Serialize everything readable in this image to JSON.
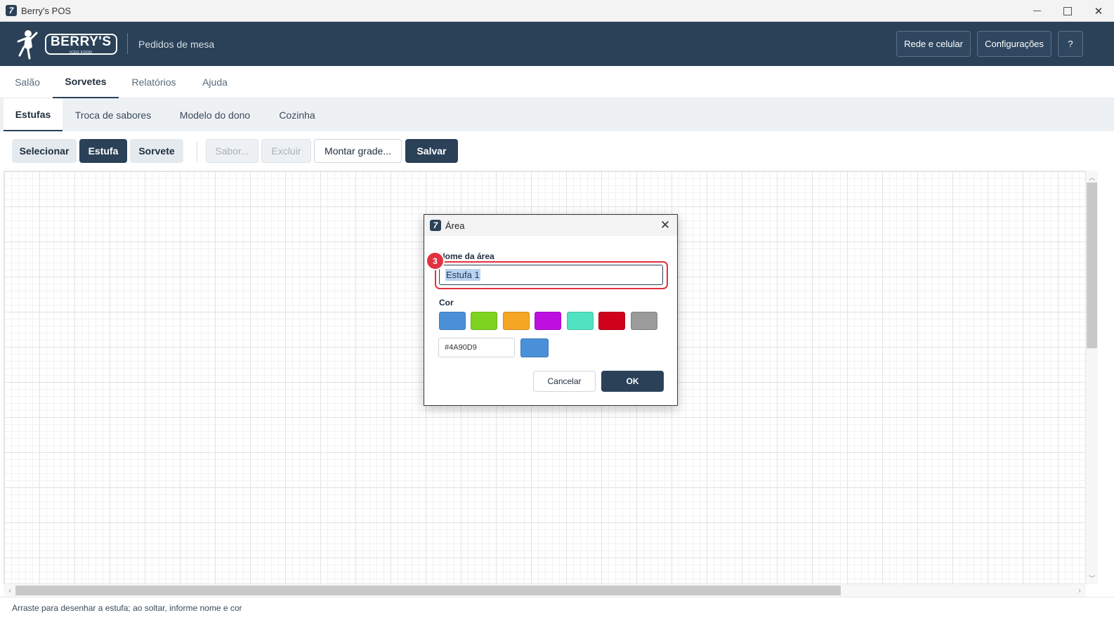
{
  "window": {
    "title": "Berry's POS",
    "app_icon_glyph": "7"
  },
  "header": {
    "logo_text": "BERRY'S",
    "logo_subtext": "ICED FOOD",
    "subtitle": "Pedidos de mesa",
    "buttons": {
      "network": "Rede e celular",
      "settings": "Configurações",
      "help": "?"
    }
  },
  "main_tabs": [
    "Salão",
    "Sorvetes",
    "Relatórios",
    "Ajuda"
  ],
  "main_tab_active": "Sorvetes",
  "sub_tabs": [
    "Estufas",
    "Troca de sabores",
    "Modelo do dono",
    "Cozinha"
  ],
  "sub_tab_active": "Estufas",
  "toolbar": {
    "select": "Selecionar",
    "estufa": "Estufa",
    "sorvete": "Sorvete",
    "sabor": "Sabor...",
    "excluir": "Excluir",
    "montar_grade": "Montar grade...",
    "salvar": "Salvar"
  },
  "status": {
    "text": "Arraste para desenhar a estufa; ao soltar, informe nome e cor"
  },
  "dialog": {
    "title": "Área",
    "name_label": "Nome da área",
    "name_value": "Estufa 1",
    "color_label": "Cor",
    "swatches": [
      "#4A90D9",
      "#7ED321",
      "#F5A623",
      "#BD10E0",
      "#50E3C2",
      "#D0021B",
      "#9B9B9B"
    ],
    "hex_value": "#4A90D9",
    "cancel": "Cancelar",
    "ok": "OK",
    "step_badge": "3"
  },
  "colors": {
    "brand_dark": "#2a4158",
    "highlight": "#e0323f"
  }
}
